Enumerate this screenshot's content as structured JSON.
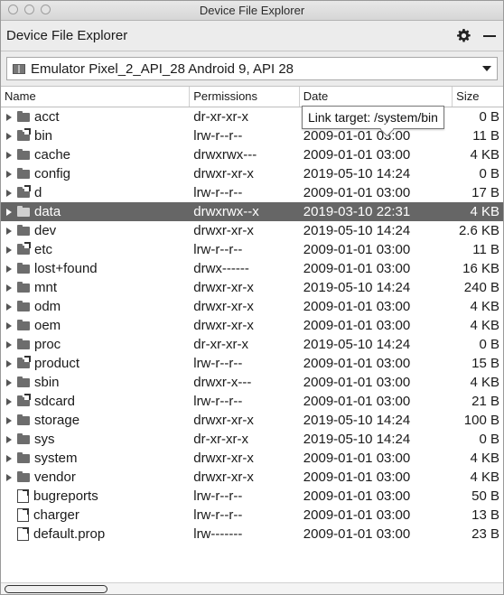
{
  "window": {
    "title": "Device File Explorer"
  },
  "tool": {
    "title": "Device File Explorer",
    "gear_icon": "gear-icon",
    "minimize_icon": "minimize-icon"
  },
  "device": {
    "selected": "Emulator Pixel_2_API_28 Android 9, API 28"
  },
  "columns": {
    "name": "Name",
    "permissions": "Permissions",
    "date": "Date",
    "size": "Size"
  },
  "tooltip": {
    "text": "Link target: /system/bin"
  },
  "rows": [
    {
      "name": "acct",
      "permissions": "dr-xr-xr-x",
      "date": "",
      "size": "0 B",
      "type": "folder"
    },
    {
      "name": "bin",
      "permissions": "lrw-r--r--",
      "date": "2009-01-01 03:00",
      "size": "11 B",
      "type": "link"
    },
    {
      "name": "cache",
      "permissions": "drwxrwx---",
      "date": "2009-01-01 03:00",
      "size": "4 KB",
      "type": "folder"
    },
    {
      "name": "config",
      "permissions": "drwxr-xr-x",
      "date": "2019-05-10 14:24",
      "size": "0 B",
      "type": "folder"
    },
    {
      "name": "d",
      "permissions": "lrw-r--r--",
      "date": "2009-01-01 03:00",
      "size": "17 B",
      "type": "link"
    },
    {
      "name": "data",
      "permissions": "drwxrwx--x",
      "date": "2019-03-10 22:31",
      "size": "4 KB",
      "type": "folder",
      "selected": true
    },
    {
      "name": "dev",
      "permissions": "drwxr-xr-x",
      "date": "2019-05-10 14:24",
      "size": "2.6 KB",
      "type": "folder"
    },
    {
      "name": "etc",
      "permissions": "lrw-r--r--",
      "date": "2009-01-01 03:00",
      "size": "11 B",
      "type": "link"
    },
    {
      "name": "lost+found",
      "permissions": "drwx------",
      "date": "2009-01-01 03:00",
      "size": "16 KB",
      "type": "folder"
    },
    {
      "name": "mnt",
      "permissions": "drwxr-xr-x",
      "date": "2019-05-10 14:24",
      "size": "240 B",
      "type": "folder"
    },
    {
      "name": "odm",
      "permissions": "drwxr-xr-x",
      "date": "2009-01-01 03:00",
      "size": "4 KB",
      "type": "folder"
    },
    {
      "name": "oem",
      "permissions": "drwxr-xr-x",
      "date": "2009-01-01 03:00",
      "size": "4 KB",
      "type": "folder"
    },
    {
      "name": "proc",
      "permissions": "dr-xr-xr-x",
      "date": "2019-05-10 14:24",
      "size": "0 B",
      "type": "folder"
    },
    {
      "name": "product",
      "permissions": "lrw-r--r--",
      "date": "2009-01-01 03:00",
      "size": "15 B",
      "type": "link"
    },
    {
      "name": "sbin",
      "permissions": "drwxr-x---",
      "date": "2009-01-01 03:00",
      "size": "4 KB",
      "type": "folder"
    },
    {
      "name": "sdcard",
      "permissions": "lrw-r--r--",
      "date": "2009-01-01 03:00",
      "size": "21 B",
      "type": "link"
    },
    {
      "name": "storage",
      "permissions": "drwxr-xr-x",
      "date": "2019-05-10 14:24",
      "size": "100 B",
      "type": "folder"
    },
    {
      "name": "sys",
      "permissions": "dr-xr-xr-x",
      "date": "2019-05-10 14:24",
      "size": "0 B",
      "type": "folder"
    },
    {
      "name": "system",
      "permissions": "drwxr-xr-x",
      "date": "2009-01-01 03:00",
      "size": "4 KB",
      "type": "folder"
    },
    {
      "name": "vendor",
      "permissions": "drwxr-xr-x",
      "date": "2009-01-01 03:00",
      "size": "4 KB",
      "type": "folder"
    },
    {
      "name": "bugreports",
      "permissions": "lrw-r--r--",
      "date": "2009-01-01 03:00",
      "size": "50 B",
      "type": "file"
    },
    {
      "name": "charger",
      "permissions": "lrw-r--r--",
      "date": "2009-01-01 03:00",
      "size": "13 B",
      "type": "file"
    },
    {
      "name": "default.prop",
      "permissions": "lrw-------",
      "date": "2009-01-01 03:00",
      "size": "23 B",
      "type": "file"
    }
  ]
}
